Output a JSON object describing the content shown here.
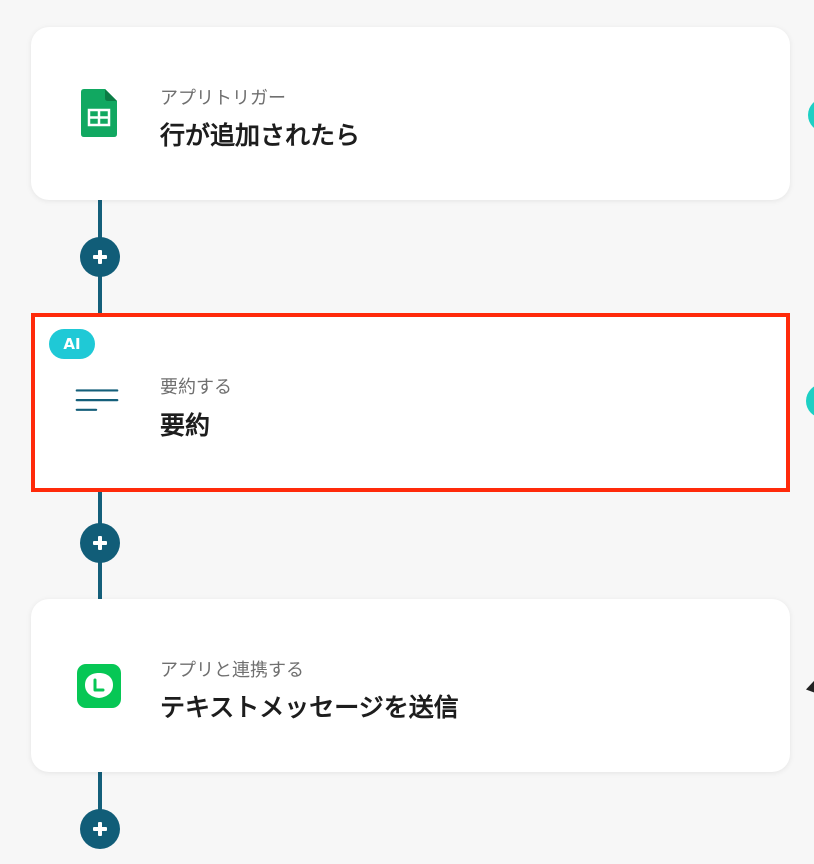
{
  "flow": {
    "steps": [
      {
        "subtitle": "アプリトリガー",
        "title": "行が追加されたら",
        "icon": "google-sheets-icon"
      },
      {
        "badge": "AI",
        "subtitle": "要約する",
        "title": "要約",
        "icon": "summarize-lines-icon"
      },
      {
        "subtitle": "アプリと連携する",
        "title": "テキストメッセージを送信",
        "icon": "line-app-icon"
      }
    ]
  },
  "colors": {
    "connector": "#145f7a",
    "add_button": "#115d78",
    "selection_border": "#ff2a0a",
    "ai_badge": "#1fc9d6",
    "side_indicator": "#1dd0c4",
    "sheets_green": "#11a861",
    "line_green": "#06c755"
  }
}
